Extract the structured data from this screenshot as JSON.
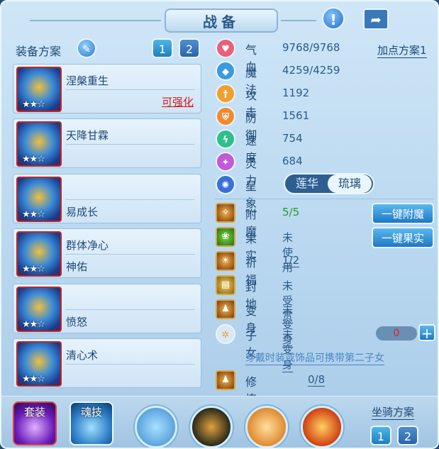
{
  "header": {
    "title": "战备"
  },
  "equip": {
    "label": "装备方案",
    "plans": [
      "1",
      "2"
    ],
    "slots": [
      {
        "name": "涅槃重生",
        "sub": "",
        "note": "可强化",
        "stars": "★★☆"
      },
      {
        "name": "天降甘霖",
        "sub": "",
        "note": "",
        "stars": "★★☆"
      },
      {
        "name": "",
        "sub": "易成长",
        "note": "",
        "stars": "★★☆"
      },
      {
        "name": "群体净心",
        "sub": "神佑",
        "note": "",
        "stars": "★★☆"
      },
      {
        "name": "",
        "sub": "愤怒",
        "note": "",
        "stars": "★★☆"
      },
      {
        "name": "清心术",
        "sub": "",
        "note": "",
        "stars": "★★☆"
      }
    ]
  },
  "stats": {
    "plan_link": "加点方案1",
    "items": [
      {
        "label": "气血",
        "value": "9768/9768",
        "icon": "heart-icon",
        "color": "#e8607a"
      },
      {
        "label": "魔法",
        "value": "4259/4259",
        "icon": "mana-icon",
        "color": "#3a9ae0"
      },
      {
        "label": "攻击",
        "value": "1192",
        "icon": "sword-icon",
        "color": "#f0a030"
      },
      {
        "label": "防御",
        "value": "1561",
        "icon": "shield-icon",
        "color": "#f08a30"
      },
      {
        "label": "速度",
        "value": "754",
        "icon": "speed-icon",
        "color": "#2ec08a"
      },
      {
        "label": "灵力",
        "value": "684",
        "icon": "spirit-icon",
        "color": "#c05ad8"
      }
    ],
    "star": {
      "label": "星象",
      "options": [
        "莲华",
        "琉璃"
      ],
      "selected": "琉璃"
    }
  },
  "extras": {
    "items": [
      {
        "label": "附魔",
        "value": "5/5",
        "icon": "enchant-icon"
      },
      {
        "label": "果实",
        "value": "未使用",
        "icon": "fruit-icon"
      },
      {
        "label": "祈福",
        "value": "1/2",
        "icon": "bless-icon"
      },
      {
        "label": "封地",
        "value": "未受赏",
        "icon": "fief-icon"
      },
      {
        "label": "变身",
        "value": "未变身",
        "icon": "transform-icon"
      },
      {
        "label": "子女",
        "value": "未变身",
        "icon": "child-icon"
      }
    ],
    "btn_enchant": "一键附魔",
    "btn_fruit": "一键果实",
    "counter": "0",
    "hint": "穿戴时装或饰品可携带第二子女",
    "practice": {
      "label": "修炼觉醒",
      "value": "0/8"
    }
  },
  "bottom": {
    "set_label": "套装",
    "soul_label": "魂技",
    "mount_label": "坐骑方案",
    "mount_plans": [
      "1",
      "2"
    ]
  }
}
